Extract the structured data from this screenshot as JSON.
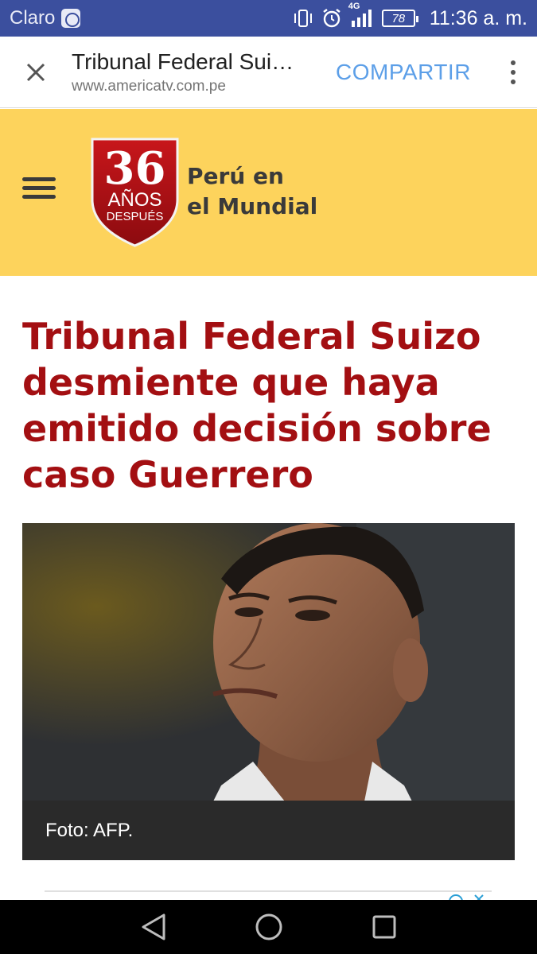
{
  "status_bar": {
    "carrier": "Claro",
    "network": "4G",
    "battery": "78",
    "time": "11:36 a. m."
  },
  "browser": {
    "page_title": "Tribunal Federal Sui…",
    "url": "www.americatv.com.pe",
    "share_label": "COMPARTIR"
  },
  "site_header": {
    "logo": {
      "number": "36",
      "line1": "AÑOS",
      "line2": "DESPUÉS"
    },
    "tagline_line1": "Perú en",
    "tagline_line2": "el Mundial"
  },
  "article": {
    "headline": "Tribunal Federal Suizo desmiente que haya emitido decisión sobre caso Guerrero",
    "photo_caption": "Foto: AFP."
  },
  "colors": {
    "status_bar": "#3b4f9e",
    "header_yellow": "#fdd35c",
    "headline_red": "#a30f12",
    "share_blue": "#5c9fe8"
  },
  "icons": [
    "whatsapp-icon",
    "vibrate-icon",
    "alarm-icon",
    "signal-icon",
    "battery-icon",
    "close-icon",
    "more-vert-icon",
    "hamburger-icon",
    "back-icon",
    "home-icon",
    "recents-icon"
  ]
}
